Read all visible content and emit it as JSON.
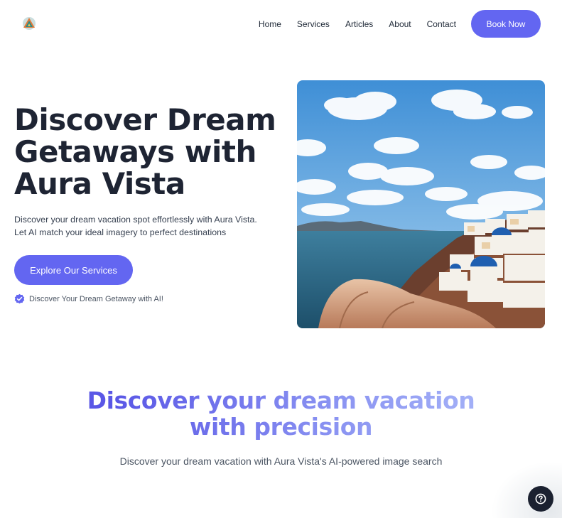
{
  "nav": {
    "logo": "aura-vista-logo",
    "links": [
      "Home",
      "Services",
      "Articles",
      "About",
      "Contact"
    ],
    "cta": "Book Now"
  },
  "hero": {
    "title": "Discover Dream Getaways with Aura Vista",
    "description": "Discover your dream vacation spot effortlessly with Aura Vista. Let AI match your ideal imagery to perfect destinations",
    "cta": "Explore Our Services",
    "badge_icon": "verified-check-icon",
    "badge_text": "Discover Your Dream Getaway with AI!"
  },
  "section": {
    "title_line1": "Discover your dream vacation",
    "title_line2": "with precision",
    "subtitle": "Discover your dream vacation with Aura Vista's AI-powered image search"
  },
  "help": {
    "icon": "question-mark-icon"
  },
  "colors": {
    "accent": "#6366f1",
    "heading": "#1e2433",
    "help_button": "#1b2130",
    "gradient": [
      "#5a57e6",
      "#8b94f2",
      "#a3b0f7"
    ]
  }
}
